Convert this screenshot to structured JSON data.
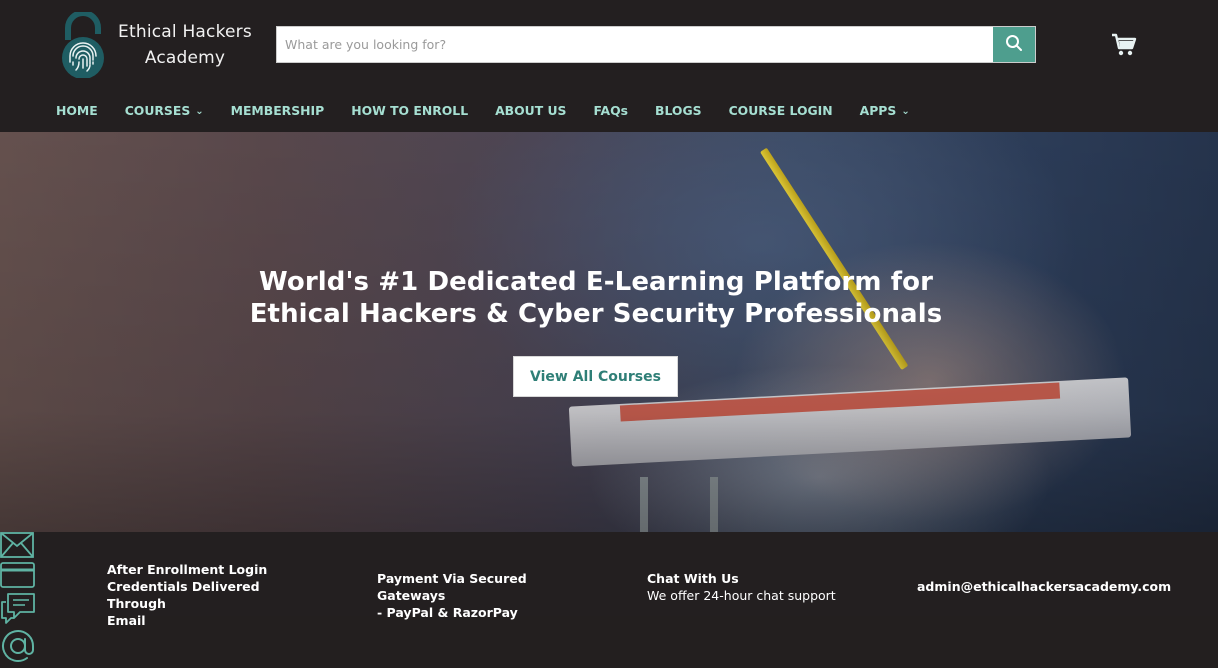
{
  "brand": {
    "name_line1": "Ethical Hackers",
    "name_line2": "Academy",
    "logo_icon": "fingerprint-lock-icon"
  },
  "search": {
    "placeholder": "What are you looking for?",
    "icon": "search-icon"
  },
  "cart": {
    "icon": "cart-icon"
  },
  "nav": {
    "items": [
      {
        "label": "HOME",
        "dropdown": false
      },
      {
        "label": "COURSES",
        "dropdown": true
      },
      {
        "label": "MEMBERSHIP",
        "dropdown": false
      },
      {
        "label": "HOW TO ENROLL",
        "dropdown": false
      },
      {
        "label": "ABOUT US",
        "dropdown": false
      },
      {
        "label": "FAQs",
        "dropdown": false
      },
      {
        "label": "BLOGS",
        "dropdown": false
      },
      {
        "label": "COURSE LOGIN",
        "dropdown": false
      },
      {
        "label": "APPS",
        "dropdown": true
      }
    ]
  },
  "hero": {
    "title_line1": "World's #1 Dedicated E-Learning Platform for",
    "title_line2": "Ethical Hackers & Cyber Security Professionals",
    "button_label": "View All Courses"
  },
  "features": {
    "email_delivery": {
      "icon": "envelope-icon",
      "line1": "After Enrollment Login",
      "line2": "Credentials Delivered Through",
      "line3": "Email"
    },
    "payment": {
      "icon": "credit-card-icon",
      "line1": "Payment Via Secured Gateways",
      "line2": "- PayPal & RazorPay"
    },
    "chat": {
      "icon": "chat-bubbles-icon",
      "title": "Chat With Us",
      "subtitle": "We offer 24-hour chat support"
    },
    "contact": {
      "icon": "at-sign-icon",
      "email": "admin@ethicalhackersacademy.com"
    }
  },
  "colors": {
    "header_bg": "#231f20",
    "accent_teal": "#4e9e8e",
    "nav_text": "#a6dfd2",
    "button_text": "#2f7f77"
  }
}
